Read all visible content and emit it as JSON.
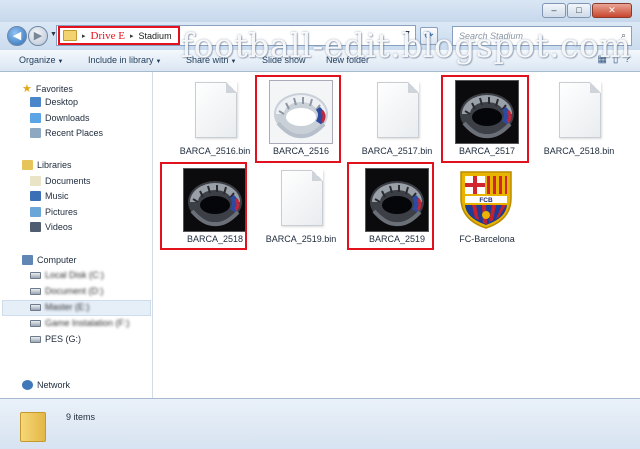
{
  "window": {
    "min": "–",
    "max": "□",
    "close": "✕"
  },
  "address": {
    "drive": "Drive E",
    "folder": "Stadium",
    "sep": "▸"
  },
  "search": {
    "placeholder": "Search Stadium"
  },
  "watermark": "football-edit.blogspot.com",
  "toolbar": {
    "organize": "Organize",
    "include": "Include in library",
    "share": "Share with",
    "slideshow": "Slide show",
    "newfolder": "New folder"
  },
  "nav": {
    "favorites": "Favorites",
    "desktop": "Desktop",
    "downloads": "Downloads",
    "recent": "Recent Places",
    "libraries": "Libraries",
    "documents": "Documents",
    "music": "Music",
    "pictures": "Pictures",
    "videos": "Videos",
    "computer": "Computer",
    "drive_c": "Local Disk (C:)",
    "drive_d": "Document (D:)",
    "drive_e": "Master (E:)",
    "drive_f": "Game Instalation (F:)",
    "drive_g": "PES (G:)",
    "network": "Network"
  },
  "files": [
    {
      "name": "BARCA_2516.bin",
      "kind": "bin"
    },
    {
      "name": "BARCA_2516",
      "kind": "stadium-light"
    },
    {
      "name": "BARCA_2517.bin",
      "kind": "bin"
    },
    {
      "name": "BARCA_2517",
      "kind": "stadium-dark"
    },
    {
      "name": "BARCA_2518.bin",
      "kind": "bin"
    },
    {
      "name": "BARCA_2518",
      "kind": "stadium-dark"
    },
    {
      "name": "BARCA_2519.bin",
      "kind": "bin"
    },
    {
      "name": "BARCA_2519",
      "kind": "stadium-dark"
    },
    {
      "name": "FC-Barcelona",
      "kind": "crest"
    }
  ],
  "crest": {
    "text": "FCB"
  },
  "status": {
    "count": "9 items"
  }
}
